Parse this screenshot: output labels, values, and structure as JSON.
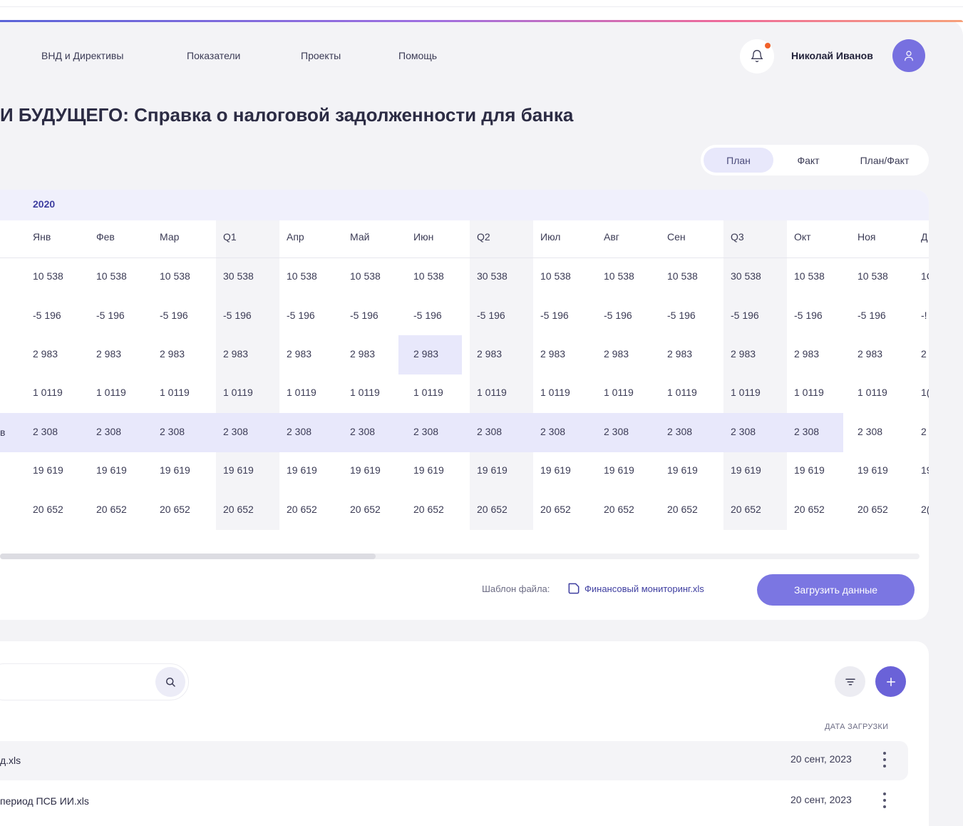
{
  "nav": {
    "items": [
      "ВНД и Директивы",
      "Показатели",
      "Проекты",
      "Помощь"
    ]
  },
  "user": {
    "name": "Николай Иванов"
  },
  "page": {
    "title": "И БУДУЩЕГО: Справка о налоговой задолженности для банка"
  },
  "view_toggle": {
    "options": [
      "План",
      "Факт",
      "План/Факт"
    ],
    "selected": "План"
  },
  "table": {
    "year": "2020",
    "columns": [
      "Янв",
      "Фев",
      "Мар",
      "Q1",
      "Апр",
      "Май",
      "Июн",
      "Q2",
      "Июл",
      "Авг",
      "Сен",
      "Q3",
      "Окт",
      "Ноя",
      "Д"
    ],
    "rows": [
      [
        "10 538",
        "10 538",
        "10 538",
        "30 538",
        "10 538",
        "10 538",
        "10 538",
        "30 538",
        "10 538",
        "10 538",
        "10 538",
        "30 538",
        "10 538",
        "10 538",
        "1C"
      ],
      [
        "-5 196",
        "-5 196",
        "-5 196",
        "-5 196",
        "-5 196",
        "-5 196",
        "-5 196",
        "-5 196",
        "-5 196",
        "-5 196",
        "-5 196",
        "-5 196",
        "-5 196",
        "-5 196",
        "-!"
      ],
      [
        "2 983",
        "2 983",
        "2 983",
        "2 983",
        "2 983",
        "2 983",
        "2 983",
        "2 983",
        "2 983",
        "2 983",
        "2 983",
        "2 983",
        "2 983",
        "2 983",
        "2"
      ],
      [
        "1 0119",
        "1 0119",
        "1 0119",
        "1 0119",
        "1 0119",
        "1 0119",
        "1 0119",
        "1 0119",
        "1 0119",
        "1 0119",
        "1 0119",
        "1 0119",
        "1 0119",
        "1 0119",
        "1("
      ],
      [
        "2 308",
        "2 308",
        "2 308",
        "2 308",
        "2 308",
        "2 308",
        "2 308",
        "2 308",
        "2 308",
        "2 308",
        "2 308",
        "2 308",
        "2 308",
        "2 308",
        "2"
      ],
      [
        "19 619",
        "19 619",
        "19 619",
        "19 619",
        "19 619",
        "19 619",
        "19 619",
        "19 619",
        "19 619",
        "19 619",
        "19 619",
        "19 619",
        "19 619",
        "19 619",
        "19"
      ],
      [
        "20 652",
        "20 652",
        "20 652",
        "20 652",
        "20 652",
        "20 652",
        "20 652",
        "20 652",
        "20 652",
        "20 652",
        "20 652",
        "20 652",
        "20 652",
        "20 652",
        "2("
      ]
    ],
    "row_label_fragment": "в"
  },
  "template": {
    "label": "Шаблон файла:",
    "file": "Финансовый мониторинг.xls"
  },
  "upload_button": "Загрузить данные",
  "files": {
    "date_column": "ДАТА ЗАГРУЗКИ",
    "items": [
      {
        "name": "д.xls",
        "date": "20 сент, 2023"
      },
      {
        "name": "период ПСБ ИИ.xls",
        "date": "20 сент, 2023"
      }
    ]
  },
  "icons": [
    "bell-icon",
    "user-icon",
    "file-icon",
    "search-icon",
    "filter-icon",
    "plus-icon",
    "kebab-icon"
  ],
  "colors": {
    "accent": "#7b76e2",
    "highlight": "#e8e8fb",
    "notification": "#f1612a",
    "link": "#3e3ea0"
  }
}
